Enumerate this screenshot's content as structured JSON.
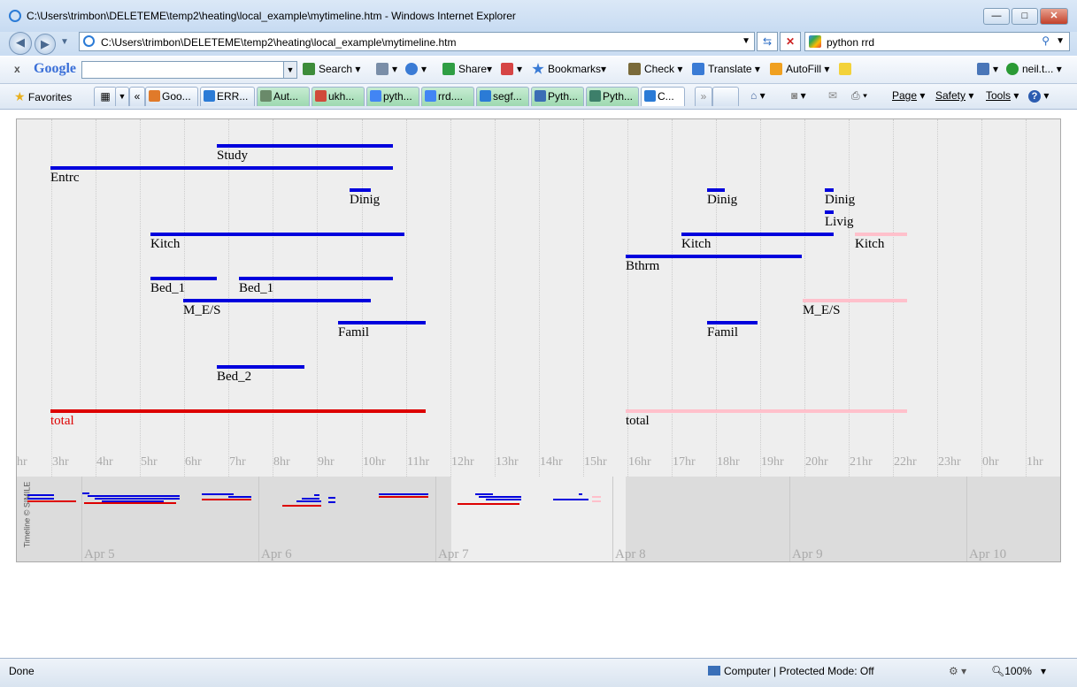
{
  "window": {
    "title": "C:\\Users\\trimbon\\DELETEME\\temp2\\heating\\local_example\\mytimeline.htm - Windows Internet Explorer",
    "minimize": "—",
    "maximize": "□",
    "close": "✕"
  },
  "address": {
    "url": "C:\\Users\\trimbon\\DELETEME\\temp2\\heating\\local_example\\mytimeline.htm",
    "search_value": "python rrd"
  },
  "google_toolbar": {
    "close": "x",
    "logo": "Google",
    "search_label": "Search",
    "share_label": "Share",
    "bookmarks_label": "Bookmarks",
    "check_label": "Check",
    "translate_label": "Translate",
    "autofill_label": "AutoFill",
    "account_label": "neil.t..."
  },
  "favorites_bar": {
    "favorites_label": "Favorites",
    "tabs": [
      {
        "label": "Goo..."
      },
      {
        "label": "ERR..."
      },
      {
        "label": "Aut..."
      },
      {
        "label": "ukh..."
      },
      {
        "label": "pyth..."
      },
      {
        "label": "rrd...."
      },
      {
        "label": "segf..."
      },
      {
        "label": "Pyth..."
      },
      {
        "label": "Pyth..."
      },
      {
        "label": "C..."
      }
    ],
    "page_label": "Page",
    "safety_label": "Safety",
    "tools_label": "Tools"
  },
  "timeline": {
    "hour_labels": [
      "hr",
      "3hr",
      "4hr",
      "5hr",
      "6hr",
      "7hr",
      "8hr",
      "9hr",
      "10hr",
      "11hr",
      "12hr",
      "13hr",
      "14hr",
      "15hr",
      "16hr",
      "17hr",
      "18hr",
      "19hr",
      "20hr",
      "21hr",
      "22hr",
      "23hr",
      "0hr",
      "1hr"
    ],
    "events": [
      {
        "label": "Study"
      },
      {
        "label": "Entrc"
      },
      {
        "label": "Dinig"
      },
      {
        "label": "Kitch"
      },
      {
        "label": "Bed_1"
      },
      {
        "label": "Bed_1"
      },
      {
        "label": "M_E/S"
      },
      {
        "label": "Famil"
      },
      {
        "label": "Bed_2"
      },
      {
        "label": "total"
      },
      {
        "label": "Dinig"
      },
      {
        "label": "Dinig"
      },
      {
        "label": "Livig"
      },
      {
        "label": "Kitch"
      },
      {
        "label": "Kitch"
      },
      {
        "label": "Bthrm"
      },
      {
        "label": "M_E/S"
      },
      {
        "label": "Famil"
      },
      {
        "label": "total"
      }
    ],
    "day_labels": [
      "Apr 5",
      "Apr 6",
      "Apr 7",
      "Apr 8",
      "Apr 9",
      "Apr 10"
    ],
    "credit": "Timeline © SIMILE",
    "colors": {
      "event": "#0000dd",
      "total": "#dd0000",
      "faded": "#ffc0cb"
    }
  },
  "status_bar": {
    "status": "Done",
    "zone": "Computer | Protected Mode: Off",
    "zoom": "100%"
  }
}
